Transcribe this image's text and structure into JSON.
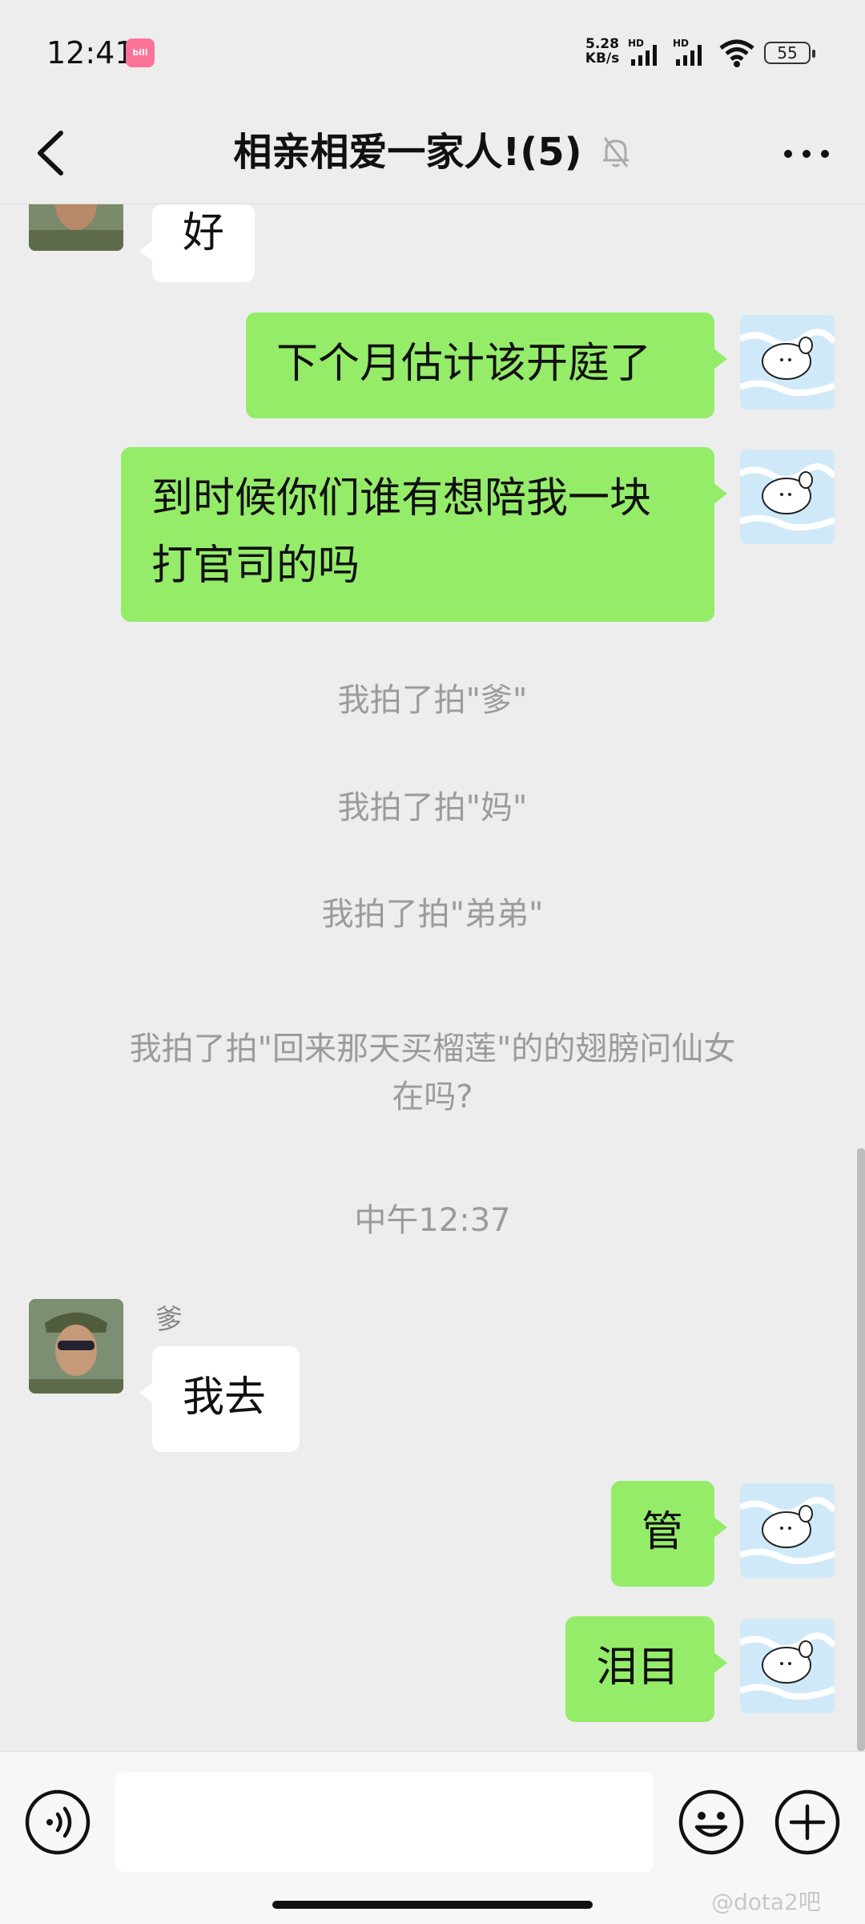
{
  "status_bar": {
    "time": "12:41",
    "app_badge": "bilibili",
    "net_speed_value": "5.28",
    "net_speed_unit": "KB/s",
    "signal_1_label": "HD",
    "signal_2_label": "HD",
    "battery": "55"
  },
  "header": {
    "title": "相亲相爱一家人!(5)",
    "muted_icon": "bell-off-icon",
    "back_icon": "back-chevron-icon",
    "more_icon": "more-dots-icon"
  },
  "messages": [
    {
      "side": "other",
      "text": "好"
    },
    {
      "side": "me",
      "text": "下个月估计该开庭了"
    },
    {
      "side": "me",
      "line1": "到时候你们谁有想陪我一块",
      "line2": "打官司的吗"
    },
    {
      "type": "system",
      "text": "我拍了拍\"爹\""
    },
    {
      "type": "system",
      "text": "我拍了拍\"妈\""
    },
    {
      "type": "system",
      "text": "我拍了拍\"弟弟\""
    },
    {
      "type": "system",
      "line1": "我拍了拍\"回来那天买榴莲\"的的翅膀问仙女",
      "line2": "在吗?"
    },
    {
      "type": "timestamp",
      "text": "中午12:37"
    },
    {
      "side": "other",
      "sender": "爹",
      "text": "我去"
    },
    {
      "side": "me",
      "text": "管"
    },
    {
      "side": "me",
      "text": "泪目"
    }
  ],
  "input_bar": {
    "voice_icon": "voice-icon",
    "input_placeholder": "",
    "emoji_icon": "emoji-icon",
    "plus_icon": "plus-icon"
  },
  "watermark": "@dota2吧",
  "colors": {
    "background": "#ededed",
    "my_bubble": "#95ec69",
    "other_bubble": "#ffffff",
    "system_text": "#9b9b9b"
  }
}
